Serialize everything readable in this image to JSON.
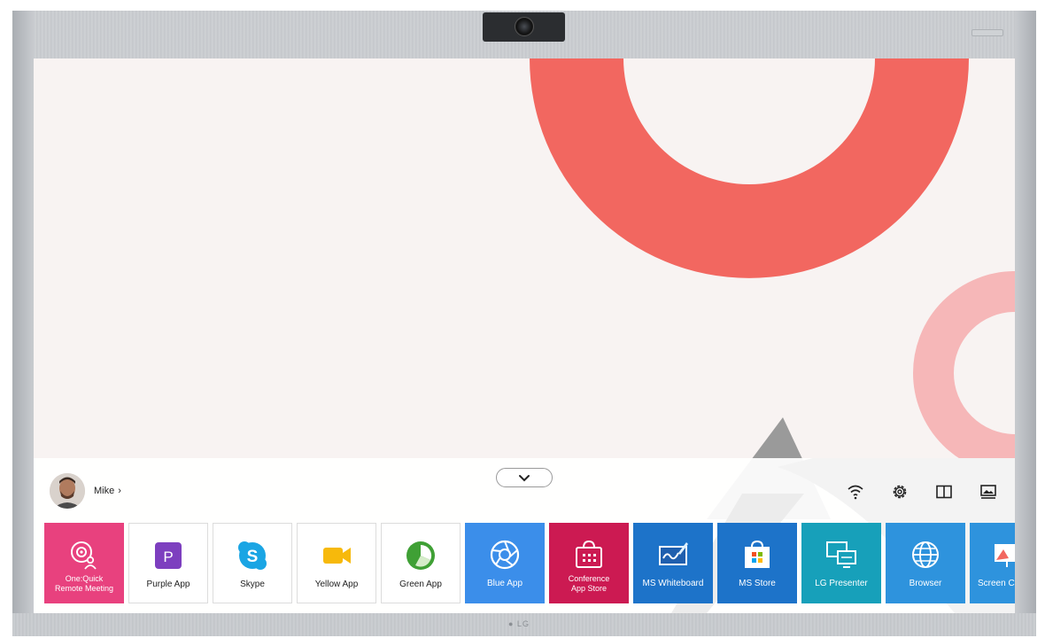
{
  "user": {
    "name": "Mike",
    "chevron": "›",
    "avatar_icon": "user-avatar-photo"
  },
  "collapse": {
    "icon": "chevron-down-icon"
  },
  "system_icons": [
    {
      "name": "wifi-icon"
    },
    {
      "name": "settings-icon"
    },
    {
      "name": "split-screen-icon"
    },
    {
      "name": "screen-image-icon"
    }
  ],
  "tiles": [
    {
      "line1": "One:Quick",
      "line2": "Remote Meeting",
      "color": "#e8417e",
      "icon": "remote-meeting-icon"
    },
    {
      "label": "Purple App",
      "color": "#ffffff",
      "icon": "purple-app-icon"
    },
    {
      "label": "Skype",
      "color": "#ffffff",
      "icon": "skype-icon"
    },
    {
      "label": "Yellow App",
      "color": "#ffffff",
      "icon": "yellow-app-icon"
    },
    {
      "label": "Green App",
      "color": "#ffffff",
      "icon": "green-app-icon"
    },
    {
      "label": "Blue App",
      "color": "#3b8eea",
      "icon": "camera-aperture-icon"
    },
    {
      "line1": "Conference",
      "line2": "App Store",
      "color": "#cc1a52",
      "icon": "shopping-bag-icon"
    },
    {
      "label": "MS Whiteboard",
      "color": "#1d73c9",
      "icon": "whiteboard-icon"
    },
    {
      "label": "MS Store",
      "color": "#1d73c9",
      "icon": "ms-store-icon"
    },
    {
      "label": "LG Presenter",
      "color": "#17a0ba",
      "icon": "presenter-icon"
    },
    {
      "label": "Browser",
      "color": "#2e93dd",
      "icon": "globe-icon"
    },
    {
      "label": "Screen C",
      "color": "#2e93dd",
      "icon": "screen-share-icon"
    }
  ],
  "colors": {
    "accent_red": "#f26760",
    "pink": "#f6b7b8"
  }
}
